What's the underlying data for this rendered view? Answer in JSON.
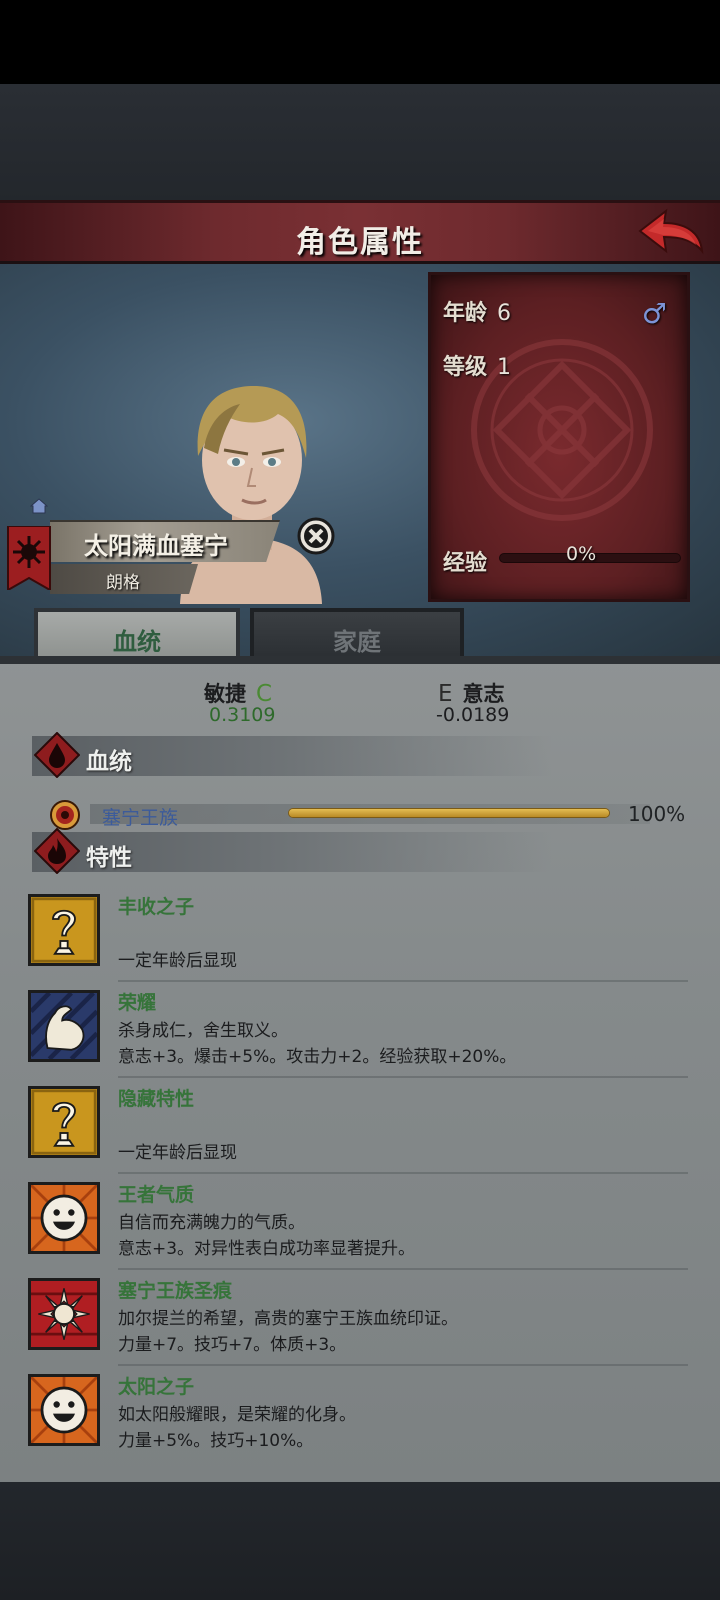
{
  "header": {
    "title": "角色属性"
  },
  "stats": {
    "age_label": "年龄",
    "age_value": "6",
    "level_label": "等级",
    "level_value": "1",
    "exp_label": "经验",
    "exp_value": "0%",
    "exp_fraction": 0,
    "gender_symbol": "♂"
  },
  "character": {
    "name": "太阳满血塞宁",
    "surname": "朗格"
  },
  "tabs": [
    {
      "label": "血统",
      "active": true
    },
    {
      "label": "家庭",
      "active": false
    }
  ],
  "attributes": {
    "left": {
      "name": "敏捷",
      "grade": "C",
      "value": "0.3109"
    },
    "right": {
      "name": "意志",
      "grade": "E",
      "value": "-0.0189"
    }
  },
  "bloodline_section": {
    "label": "血统"
  },
  "bloodline": {
    "name": "塞宁王族",
    "percent": "100%",
    "fraction": 1.0
  },
  "traits_section": {
    "label": "特性"
  },
  "traits": [
    {
      "name": "丰收之子",
      "line1": "",
      "line2": "一定年龄后显现",
      "icon": "question-icon"
    },
    {
      "name": "荣耀",
      "line1": "杀身成仁，舍生取义。",
      "line2": "意志+3。爆击+5%。攻击力+2。经验获取+20%。",
      "icon": "muscle-icon"
    },
    {
      "name": "隐藏特性",
      "line1": "",
      "line2": "一定年龄后显现",
      "icon": "question-icon"
    },
    {
      "name": "王者气质",
      "line1": "自信而充满魄力的气质。",
      "line2": "意志+3。对异性表白成功率显著提升。",
      "icon": "smile-icon"
    },
    {
      "name": "塞宁王族圣痕",
      "line1": "加尔提兰的希望，高贵的塞宁王族血统印证。",
      "line2": "力量+7。技巧+7。体质+3。",
      "icon": "sun-emblem-icon"
    },
    {
      "name": "太阳之子",
      "line1": "如太阳般耀眼，是荣耀的化身。",
      "line2": "力量+5%。技巧+10%。",
      "icon": "smile-icon"
    }
  ],
  "colors": {
    "header_red": "#7a3034",
    "panel_red": "#5c1f22",
    "trait_green": "#36743a",
    "bloodline_blue": "#3c5b9a",
    "bloodline_gold": "#c99b2f"
  }
}
